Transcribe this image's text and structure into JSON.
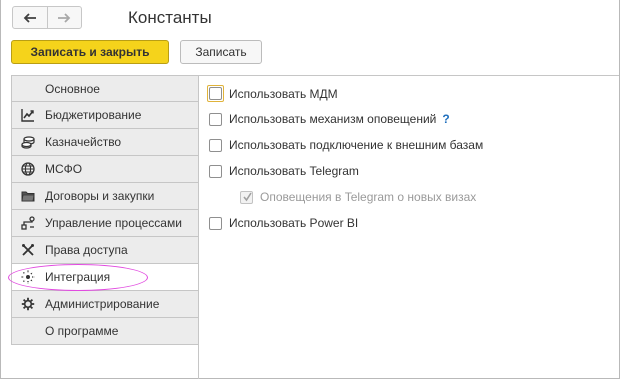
{
  "window": {
    "title": "Константы"
  },
  "nav": {
    "back_icon": "arrow-left-icon",
    "forward_icon": "arrow-right-icon"
  },
  "toolbar": {
    "save_close_label": "Записать и закрыть",
    "save_label": "Записать"
  },
  "sidebar": {
    "items": [
      {
        "label": "Основное",
        "icon": ""
      },
      {
        "label": "Бюджетирование",
        "icon": "chart-icon"
      },
      {
        "label": "Казначейство",
        "icon": "coins-icon"
      },
      {
        "label": "МСФО",
        "icon": "globe-icon"
      },
      {
        "label": "Договоры и закупки",
        "icon": "folder-icon"
      },
      {
        "label": "Управление процессами",
        "icon": "process-icon"
      },
      {
        "label": "Права доступа",
        "icon": "tools-icon"
      },
      {
        "label": "Интеграция",
        "icon": "integration-icon",
        "active": true,
        "highlighted": true
      },
      {
        "label": "Администрирование",
        "icon": "gear-icon"
      },
      {
        "label": "О программе",
        "icon": ""
      }
    ]
  },
  "options": [
    {
      "label": "Использовать МДМ",
      "checked": false,
      "focused": true
    },
    {
      "label": "Использовать механизм оповещений",
      "checked": false,
      "help": "?"
    },
    {
      "label": "Использовать подключение к внешним базам",
      "checked": false
    },
    {
      "label": "Использовать Telegram",
      "checked": false
    },
    {
      "label": "Оповещения в Telegram о новых визах",
      "checked": true,
      "disabled": true
    },
    {
      "label": "Использовать Power BI",
      "checked": false
    }
  ],
  "colors": {
    "primary_button": "#f5d31b",
    "highlight_ring": "#e14be0",
    "help_link": "#1f6fbd"
  }
}
